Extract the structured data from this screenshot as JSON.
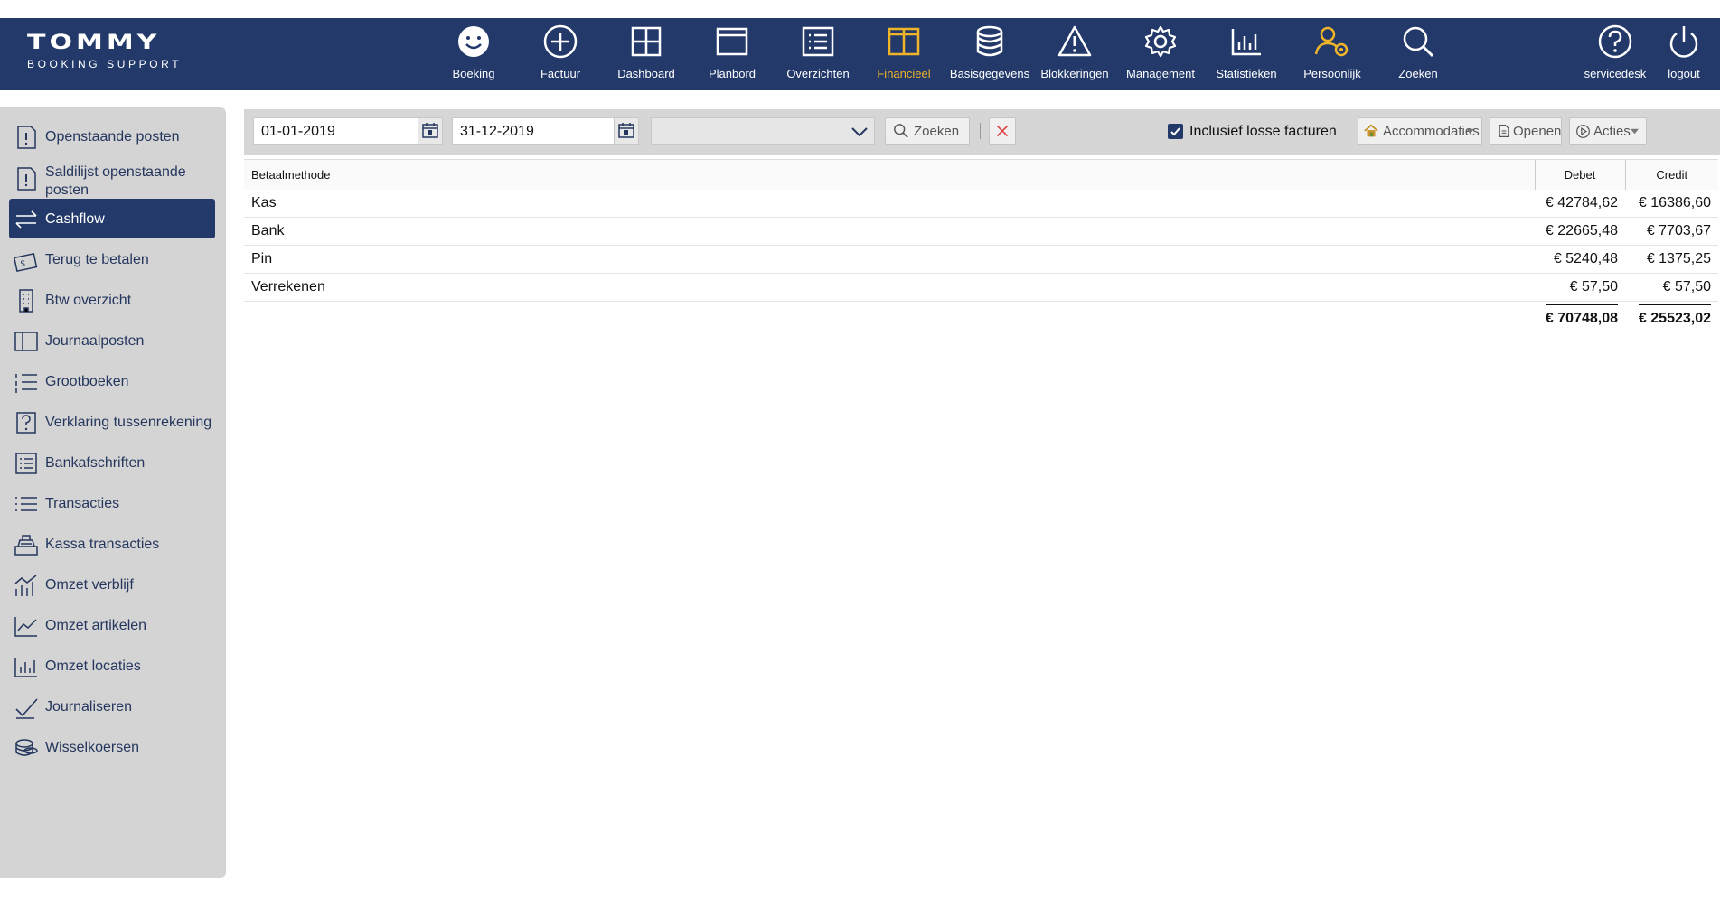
{
  "brand": {
    "name": "TOMMY",
    "tagline": "BOOKING SUPPORT"
  },
  "colors": {
    "topbar": "#22396a",
    "active_nav": "#f0b429",
    "sidebar": "#d4d4d4",
    "sidebar_active": "#22396a"
  },
  "nav": {
    "items": [
      {
        "label": "Boeking",
        "icon": "smiley-icon"
      },
      {
        "label": "Factuur",
        "icon": "plus-circle-icon"
      },
      {
        "label": "Dashboard",
        "icon": "grid-icon"
      },
      {
        "label": "Planbord",
        "icon": "window-icon"
      },
      {
        "label": "Overzichten",
        "icon": "list-icon"
      },
      {
        "label": "Financieel",
        "icon": "columns-icon",
        "active": true
      },
      {
        "label": "Basisgegevens",
        "icon": "database-icon"
      },
      {
        "label": "Blokkeringen",
        "icon": "warning-icon"
      },
      {
        "label": "Management",
        "icon": "gear-icon"
      },
      {
        "label": "Statistieken",
        "icon": "bar-chart-icon"
      },
      {
        "label": "Persoonlijk",
        "icon": "user-gear-icon"
      },
      {
        "label": "Zoeken",
        "icon": "search-icon"
      }
    ],
    "right": [
      {
        "label": "servicedesk",
        "icon": "help-icon"
      },
      {
        "label": "logout",
        "icon": "power-icon"
      }
    ]
  },
  "sidebar": {
    "items": [
      {
        "label": "Openstaande posten",
        "icon": "document-alert-icon"
      },
      {
        "label": "Saldilijst openstaande posten",
        "icon": "document-alert-icon"
      },
      {
        "label": "Cashflow",
        "icon": "transfer-arrows-icon",
        "active": true
      },
      {
        "label": "Terug te betalen",
        "icon": "refund-icon"
      },
      {
        "label": "Btw overzicht",
        "icon": "building-icon"
      },
      {
        "label": "Journaalposten",
        "icon": "book-icon"
      },
      {
        "label": "Grootboeken",
        "icon": "numbered-list-icon"
      },
      {
        "label": "Verklaring tussenrekening",
        "icon": "question-box-icon"
      },
      {
        "label": "Bankafschriften",
        "icon": "statement-icon"
      },
      {
        "label": "Transacties",
        "icon": "list-icon"
      },
      {
        "label": "Kassa transacties",
        "icon": "cash-register-icon"
      },
      {
        "label": "Omzet verblijf",
        "icon": "revenue-chart-icon"
      },
      {
        "label": "Omzet artikelen",
        "icon": "trend-chart-icon"
      },
      {
        "label": "Omzet locaties",
        "icon": "bar-chart-icon"
      },
      {
        "label": "Journaliseren",
        "icon": "check-icon"
      },
      {
        "label": "Wisselkoersen",
        "icon": "coins-icon"
      }
    ]
  },
  "toolbar": {
    "date_from": "01-01-2019",
    "date_to": "31-12-2019",
    "select_value": "",
    "search_label": "Zoeken",
    "checkbox_label": "Inclusief losse facturen",
    "checkbox_checked": true,
    "accommodaties_label": "Accommodaties",
    "openen_label": "Openen",
    "acties_label": "Acties"
  },
  "table": {
    "headers": [
      "Betaalmethode",
      "Debet",
      "Credit"
    ],
    "rows": [
      [
        "Kas",
        "€ 42784,62",
        "€ 16386,60"
      ],
      [
        "Bank",
        "€ 22665,48",
        "€ 7703,67"
      ],
      [
        "Pin",
        "€ 5240,48",
        "€ 1375,25"
      ],
      [
        "Verrekenen",
        "€ 57,50",
        "€ 57,50"
      ]
    ],
    "totals": [
      "",
      "€ 70748,08",
      "€ 25523,02"
    ]
  }
}
